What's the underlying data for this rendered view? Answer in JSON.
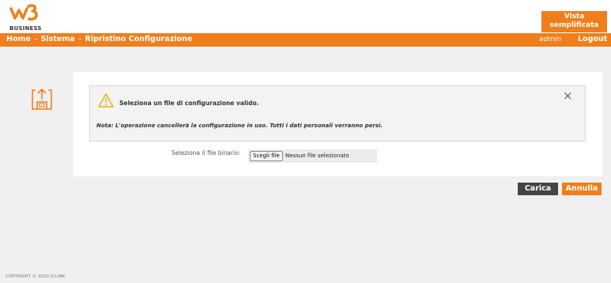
{
  "header": {
    "brand_sub": "BUSINESS",
    "vista_button": [
      "Vista",
      "semplificata"
    ]
  },
  "nav": {
    "breadcrumb": [
      "Home",
      "Sistema",
      "Ripristino Configurazione"
    ],
    "separator": "–",
    "user": "admin",
    "logout": "Logout"
  },
  "section": {
    "icon": "upload-file-icon"
  },
  "alert": {
    "icon": "warning-icon",
    "title": "Seleziona un file di configurazione valido.",
    "note": "Nota: L'operazione cancellerà la configurazione in uso. Tutti i dati personali verranno persi.",
    "close_label": "×"
  },
  "file_input": {
    "label": "Seleziona il file binario:",
    "button": "Scegli file",
    "status": "Nessun file selezionato"
  },
  "actions": {
    "load": "Carica",
    "cancel": "Annulla"
  },
  "footer": {
    "copyright": "COPYRIGHT © 2020 D-LINK"
  },
  "colors": {
    "accent": "#f07e1b",
    "dark_button": "#444444"
  }
}
